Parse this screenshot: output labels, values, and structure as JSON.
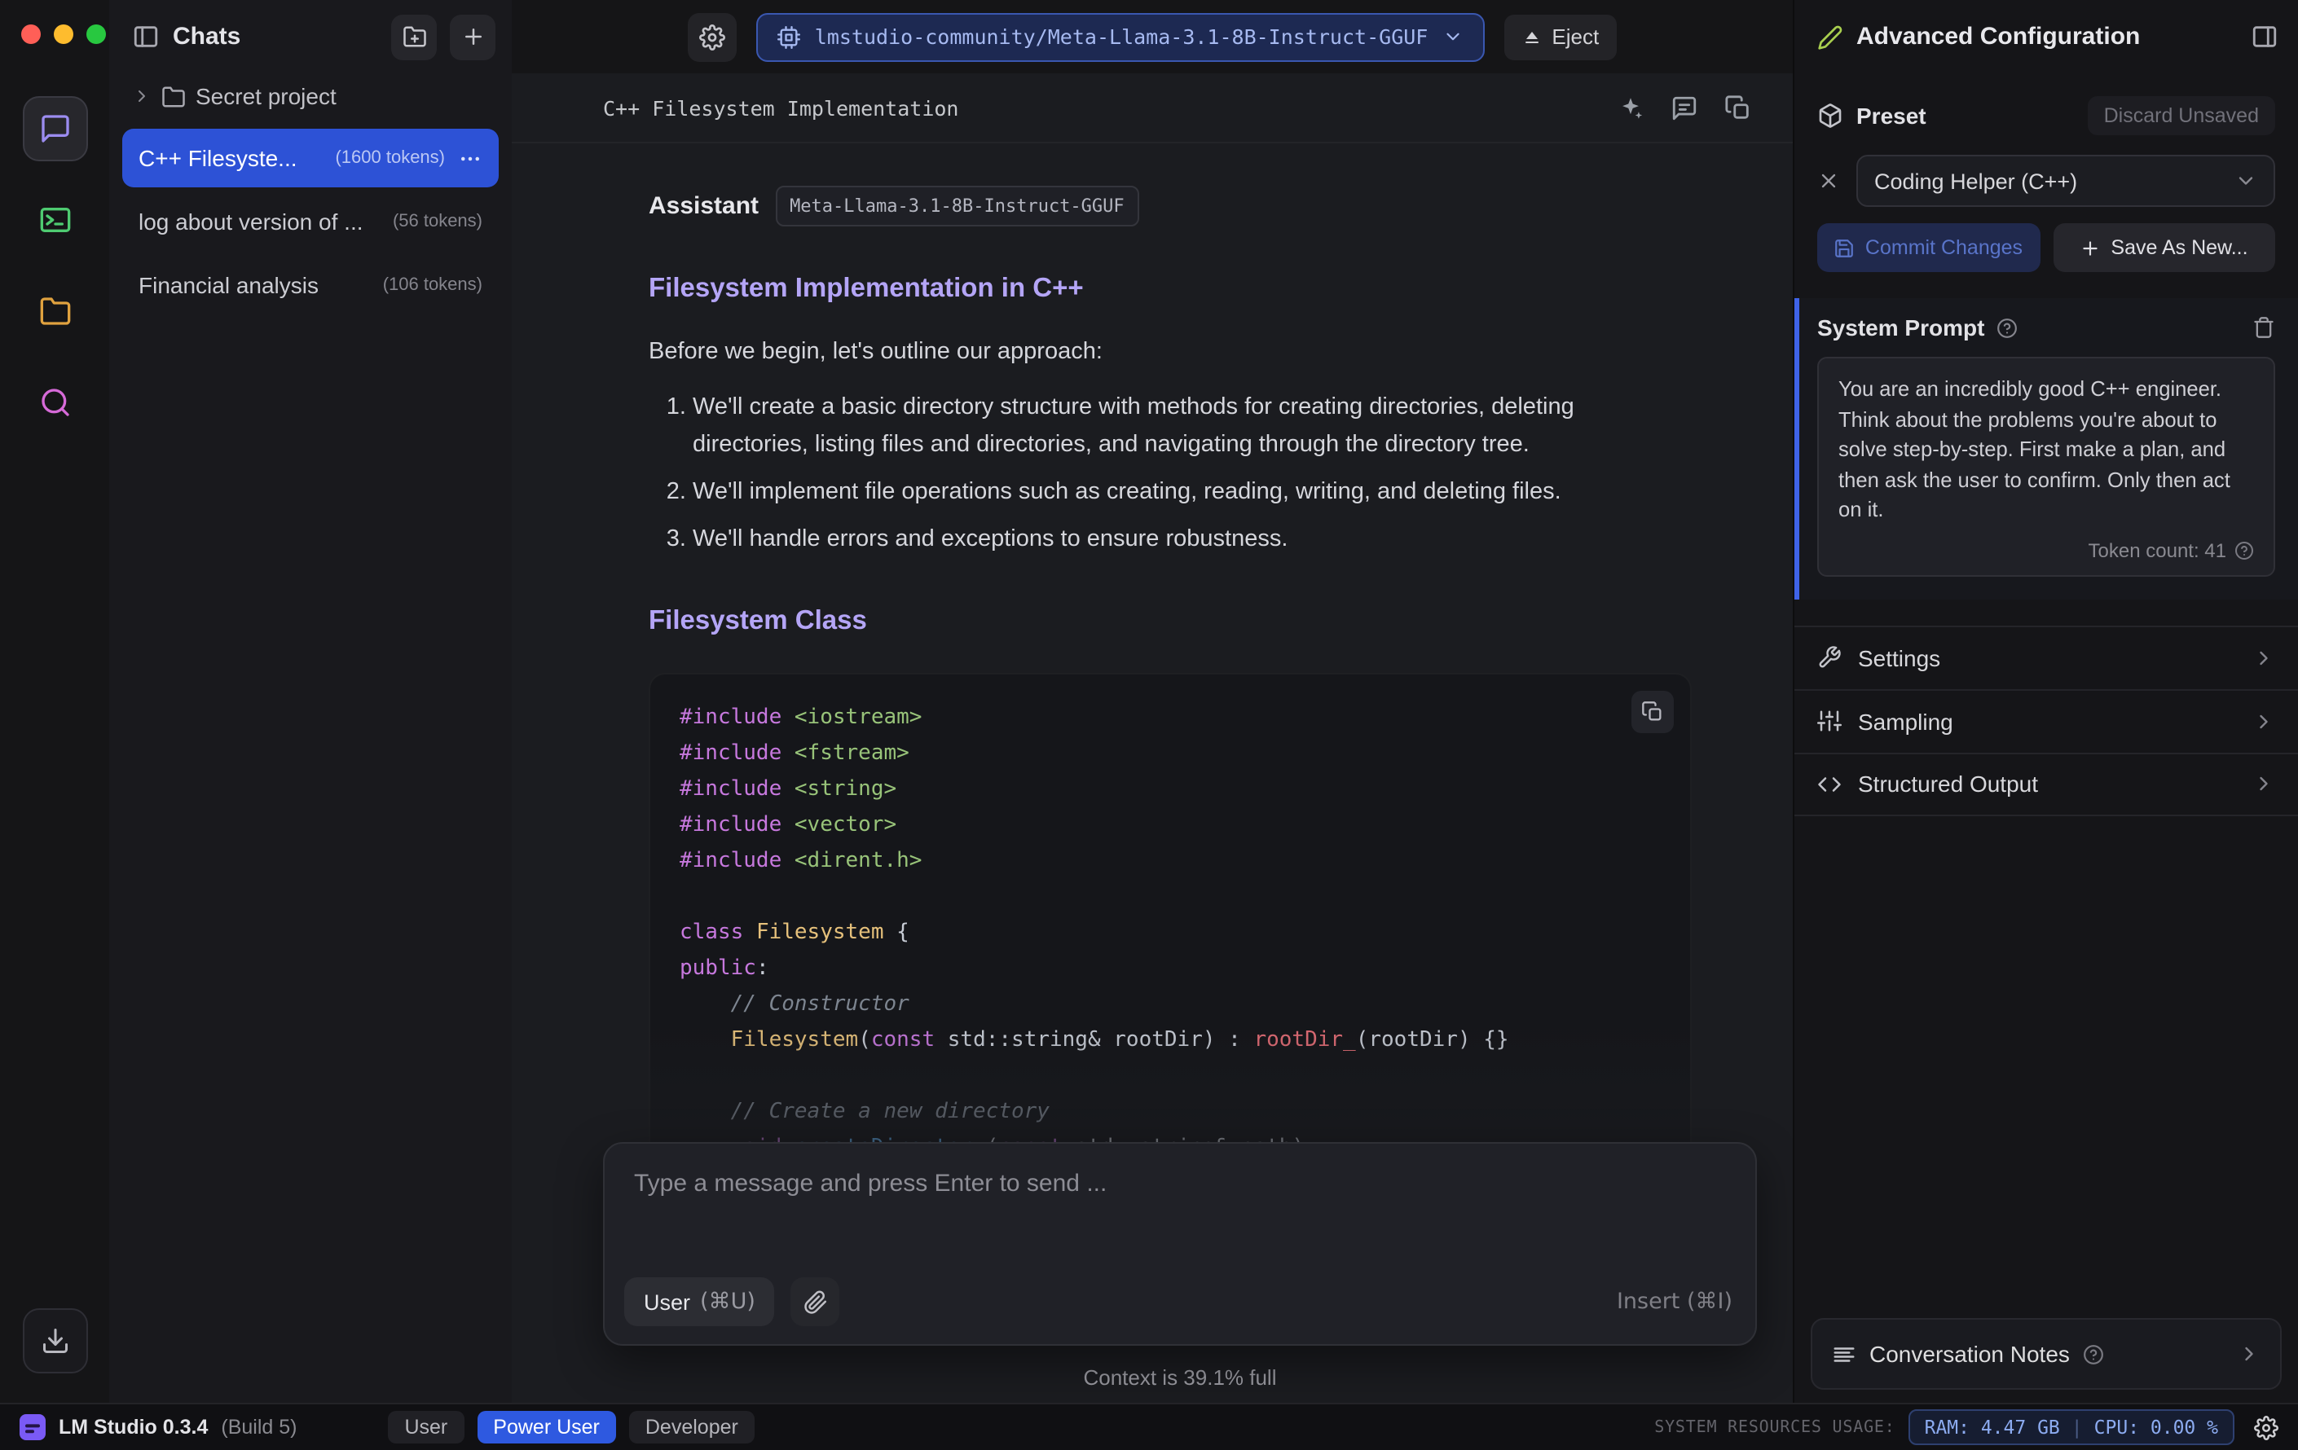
{
  "colors": {
    "accent_blue": "#2d52d6",
    "heading_purple": "#b4a5f6",
    "model_pill_blue": "#1d2952",
    "rail_terminal_green": "#4ecb71",
    "rail_folder_orange": "#e0a23f",
    "rail_search_pink": "#d66ad8"
  },
  "icons": [
    "panel-left-icon",
    "folder-plus-icon",
    "plus-icon",
    "chevron-right-icon",
    "chevron-down-icon",
    "more-icon",
    "gear-icon",
    "cpu-icon",
    "eject-icon",
    "wand-icon",
    "chat-notes-icon",
    "duplicate-icon",
    "copy-icon",
    "paperclip-icon",
    "pencil-icon",
    "panel-right-icon",
    "package-icon",
    "close-icon",
    "save-icon",
    "help-icon",
    "trash-icon",
    "wrench-icon",
    "sliders-icon",
    "structured-output-icon",
    "notes-icon",
    "download-icon",
    "chat-bubble-icon",
    "terminal-icon",
    "folder-icon",
    "search-icon"
  ],
  "sidebar": {
    "title": "Chats",
    "folder_label": "Secret project",
    "chats": [
      {
        "title": "C++ Filesyste...",
        "tokens": "(1600 tokens)",
        "selected": true
      },
      {
        "title": "log about version of ...",
        "tokens": "(56 tokens)",
        "selected": false
      },
      {
        "title": "Financial analysis",
        "tokens": "(106 tokens)",
        "selected": false
      }
    ]
  },
  "topbar": {
    "model_name": "lmstudio-community/Meta-Llama-3.1-8B-Instruct-GGUF",
    "eject_label": "Eject"
  },
  "chat": {
    "title": "C++ Filesystem Implementation",
    "assistant_label": "Assistant",
    "model_badge": "Meta-Llama-3.1-8B-Instruct-GGUF",
    "heading1": "Filesystem Implementation in C++",
    "intro": "Before we begin, let's outline our approach:",
    "list": [
      "We'll create a basic directory structure with methods for creating directories, deleting directories, listing files and directories, and navigating through the directory tree.",
      "We'll implement file operations such as creating, reading, writing, and deleting files.",
      "We'll handle errors and exceptions to ensure robustness."
    ],
    "heading2": "Filesystem Class",
    "code": [
      [
        [
          "kw",
          "#include"
        ],
        [
          "pl",
          " "
        ],
        [
          "str",
          "<iostream>"
        ]
      ],
      [
        [
          "kw",
          "#include"
        ],
        [
          "pl",
          " "
        ],
        [
          "str",
          "<fstream>"
        ]
      ],
      [
        [
          "kw",
          "#include"
        ],
        [
          "pl",
          " "
        ],
        [
          "str",
          "<string>"
        ]
      ],
      [
        [
          "kw",
          "#include"
        ],
        [
          "pl",
          " "
        ],
        [
          "str",
          "<vector>"
        ]
      ],
      [
        [
          "kw",
          "#include"
        ],
        [
          "pl",
          " "
        ],
        [
          "str",
          "<dirent.h>"
        ]
      ],
      [],
      [
        [
          "kw",
          "class"
        ],
        [
          "pl",
          " "
        ],
        [
          "ty",
          "Filesystem"
        ],
        [
          "pl",
          " {"
        ]
      ],
      [
        [
          "kw",
          "public"
        ],
        [
          "pl",
          ":"
        ]
      ],
      [
        [
          "pl",
          "    "
        ],
        [
          "cm",
          "// Constructor"
        ]
      ],
      [
        [
          "pl",
          "    "
        ],
        [
          "ty",
          "Filesystem"
        ],
        [
          "pl",
          "("
        ],
        [
          "kw",
          "const"
        ],
        [
          "pl",
          " std::string& rootDir) : "
        ],
        [
          "rd",
          "rootDir_"
        ],
        [
          "pl",
          "(rootDir) {}"
        ]
      ],
      [],
      [
        [
          "pl",
          "    "
        ],
        [
          "cm",
          "// Create a new directory"
        ]
      ],
      [
        [
          "pl",
          "    "
        ],
        [
          "kw",
          "void"
        ],
        [
          "pl",
          " "
        ],
        [
          "fn",
          "createDirectory"
        ],
        [
          "pl",
          "("
        ],
        [
          "kw",
          "const"
        ],
        [
          "pl",
          " std::string& path);"
        ]
      ]
    ]
  },
  "composer": {
    "placeholder": "Type a message and press Enter to send ...",
    "user_button": "User",
    "user_shortcut": "(⌘U)",
    "insert_label": "Insert (⌘I)",
    "context_status": "Context is 39.1% full"
  },
  "config": {
    "title": "Advanced Configuration",
    "preset": {
      "label": "Preset",
      "discard": "Discard Unsaved",
      "selected": "Coding Helper (C++)",
      "commit": "Commit Changes",
      "save_as": "Save As New..."
    },
    "system_prompt": {
      "label": "System Prompt",
      "text": "You are an incredibly good C++ engineer. Think about the problems you're about to solve step-by-step. First make a plan, and then ask the user to confirm. Only then act on it.",
      "token_count": "Token count: 41"
    },
    "sections": [
      {
        "label": "Settings"
      },
      {
        "label": "Sampling"
      },
      {
        "label": "Structured Output"
      }
    ],
    "notes_label": "Conversation Notes"
  },
  "status": {
    "app_name": "LM Studio 0.3.4",
    "build": "(Build 5)",
    "modes": [
      "User",
      "Power User",
      "Developer"
    ],
    "active_mode": "Power User",
    "resources_label": "SYSTEM RESOURCES USAGE:",
    "ram": "RAM: 4.47 GB",
    "sep": "|",
    "cpu": "CPU: 0.00 %"
  }
}
